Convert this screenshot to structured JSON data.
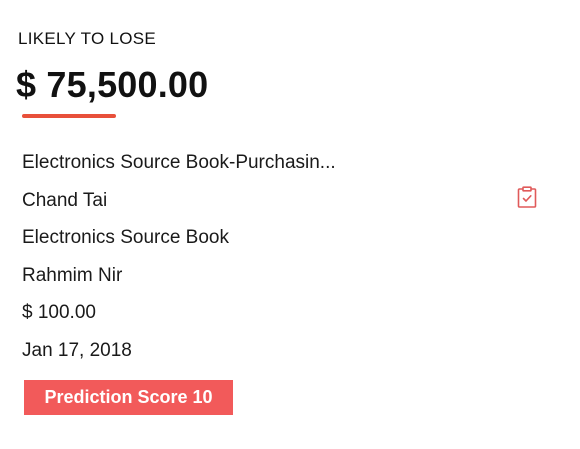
{
  "card": {
    "status_label": "LIKELY TO LOSE",
    "amount": "$ 75,500.00",
    "details": {
      "opportunity_name": "Electronics Source Book-Purchasin...",
      "contact_name": "Chand Tai",
      "account_name": "Electronics Source Book",
      "owner_name": "Rahmim Nir",
      "value": "$ 100.00",
      "date": "Jan 17, 2018"
    },
    "prediction_badge": "Prediction Score 10",
    "task_icon": "clipboard-check-icon"
  },
  "colors": {
    "accent": "#e8503a",
    "badge_background": "#f25a5a",
    "icon": "#e05a5a"
  }
}
